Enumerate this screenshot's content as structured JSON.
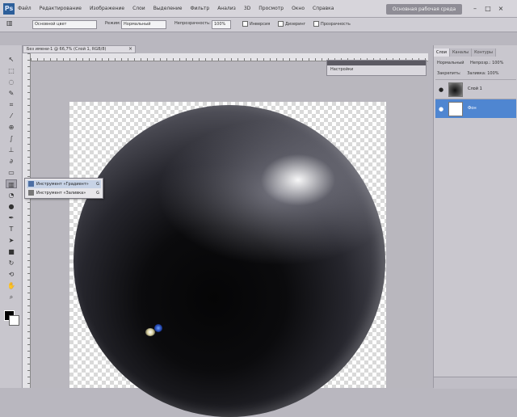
{
  "app": {
    "logo": "Ps"
  },
  "menubar": {
    "items": [
      "Файл",
      "Редактирование",
      "Изображение",
      "Слои",
      "Выделение",
      "Фильтр",
      "Анализ",
      "3D",
      "Просмотр",
      "Окно",
      "Справка"
    ],
    "workspace_button": "Основная рабочая среда",
    "win_min": "–",
    "win_max": "□",
    "win_close": "×"
  },
  "options": {
    "preset": "Основной цвет",
    "mode_label": "Режим:",
    "mode_value": "Нормальный",
    "opacity_label": "Непрозрачность:",
    "opacity_value": "100%",
    "reverse_label": "Инверсия",
    "dither_label": "Дизеринг",
    "transparency_label": "Прозрачность"
  },
  "document": {
    "tab_title": "Без имени-1 @ 66,7% (Слой 1, RGB/8)",
    "close": "×"
  },
  "flyout": {
    "items": [
      {
        "label": "Инструмент «Градиент»",
        "key": "G"
      },
      {
        "label": "Инструмент «Заливка»",
        "key": "G"
      }
    ]
  },
  "mini_panel": {
    "label": "Настройки"
  },
  "layers_panel": {
    "tabs": [
      "Слои",
      "Каналы",
      "Контуры"
    ],
    "blend_mode": "Нормальный",
    "opacity": "Непрозр.: 100%",
    "lock": "Закрепить:",
    "fill": "Заливка: 100%",
    "layers": [
      {
        "name": "Слой 1",
        "selected": false
      },
      {
        "name": "Фон",
        "selected": true
      }
    ]
  },
  "colors": {
    "foreground": "#000000",
    "background": "#ffffff",
    "selection": "#4f86d1"
  }
}
